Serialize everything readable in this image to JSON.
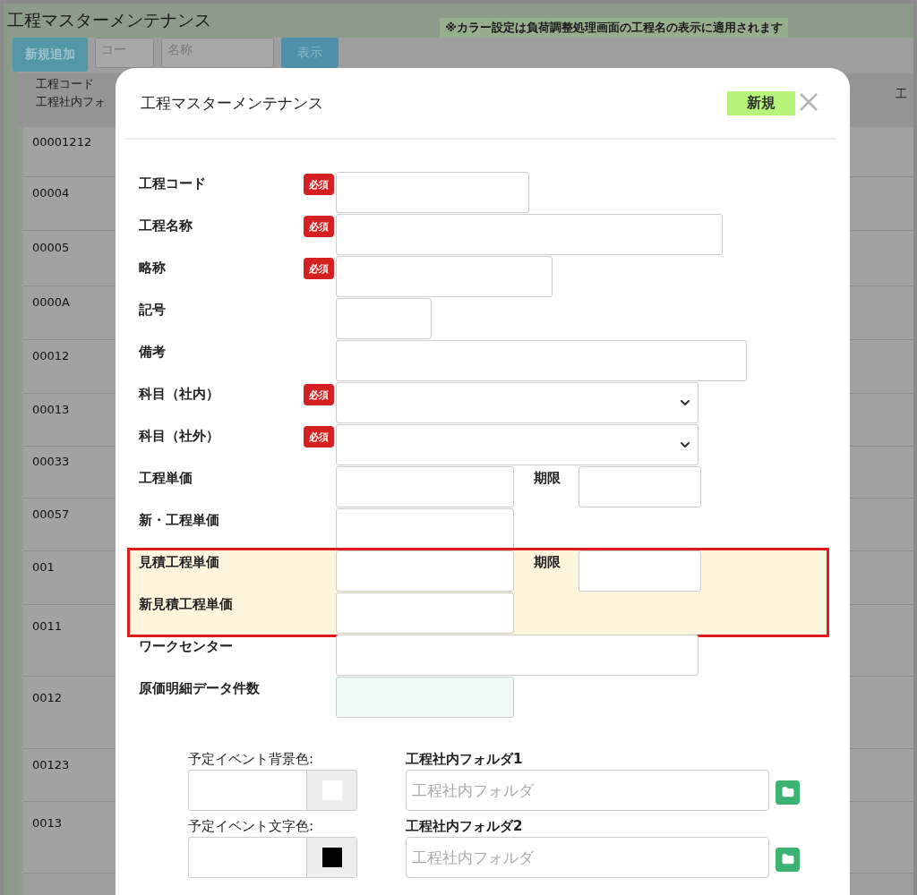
{
  "page": {
    "title": "工程マスターメンテナンス",
    "note": "※カラー設定は負荷調整処理画面の工程名の表示に適用されます"
  },
  "toolbar": {
    "add_button": "新規追加",
    "code_placeholder": "コー",
    "name_placeholder": "名称",
    "show_button": "表示"
  },
  "table": {
    "column_1": [
      "工程コード",
      "工程社内フォ"
    ],
    "column_2": "工",
    "rows": [
      "00001212",
      "00004",
      "00005",
      "0000A",
      "00012",
      "00013",
      "00033",
      "00057",
      "001",
      "0011",
      "0012",
      "00123",
      "0013"
    ]
  },
  "modal": {
    "title": "工程マスターメンテナンス",
    "mode_badge": "新規",
    "fields": [
      {
        "label": "工程コード",
        "kind": "text",
        "badge": "必須"
      },
      {
        "label": "工程名称",
        "kind": "text",
        "badge": "必須"
      },
      {
        "label": "略称",
        "kind": "text",
        "badge": "必須"
      },
      {
        "label": "記号",
        "kind": "text"
      },
      {
        "label": "備考",
        "kind": "text"
      },
      {
        "label": "科目（社内）",
        "kind": "select",
        "badge": "必須"
      },
      {
        "label": "科目（社外）",
        "kind": "select",
        "badge": "必須"
      },
      {
        "label": "工程単価",
        "kind": "text",
        "extra_label": "期限"
      },
      {
        "label": "新・工程単価",
        "kind": "text"
      },
      {
        "label": "見積工程単価",
        "kind": "text",
        "extra_label": "期限",
        "highlighted": true
      },
      {
        "label": "新見積工程単価",
        "kind": "text",
        "highlighted": true
      },
      {
        "label": "ワークセンター",
        "kind": "text"
      },
      {
        "label": "原価明細データ件数",
        "kind": "readonly"
      }
    ],
    "colors": [
      {
        "label": "予定イベント背景色:",
        "color": "#ffffff"
      },
      {
        "label": "予定イベント文字色:",
        "color": "#000000"
      }
    ],
    "folders": [
      {
        "label": "工程社内フォルダ1",
        "placeholder": "工程社内フォルダ"
      },
      {
        "label": "工程社内フォルダ2",
        "placeholder": "工程社内フォルダ"
      }
    ]
  }
}
